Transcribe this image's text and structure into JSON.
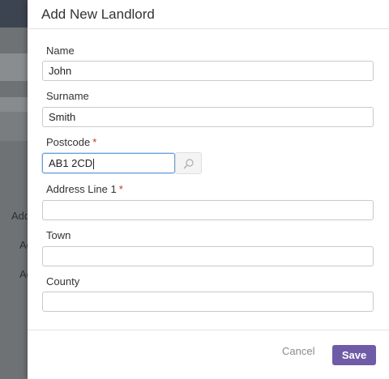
{
  "background": {
    "text_1": "Add",
    "text_2": "Ad",
    "text_3": "Ad"
  },
  "modal": {
    "title": "Add New Landlord",
    "fields": {
      "name": {
        "label": "Name",
        "value": "John"
      },
      "surname": {
        "label": "Surname",
        "value": "Smith"
      },
      "postcode": {
        "label": "Postcode",
        "required_mark": "*",
        "value": "AB1 2CD"
      },
      "address_line_1": {
        "label": "Address Line 1",
        "required_mark": "*",
        "value": ""
      },
      "town": {
        "label": "Town",
        "value": ""
      },
      "county": {
        "label": "County",
        "value": ""
      }
    },
    "search_icon": "magnifier-icon",
    "cancel_label": "Cancel",
    "save_label": "Save"
  },
  "colors": {
    "save_button": "#6f5ca7",
    "required": "#c9302c",
    "focus_border": "#6a9fd8"
  }
}
